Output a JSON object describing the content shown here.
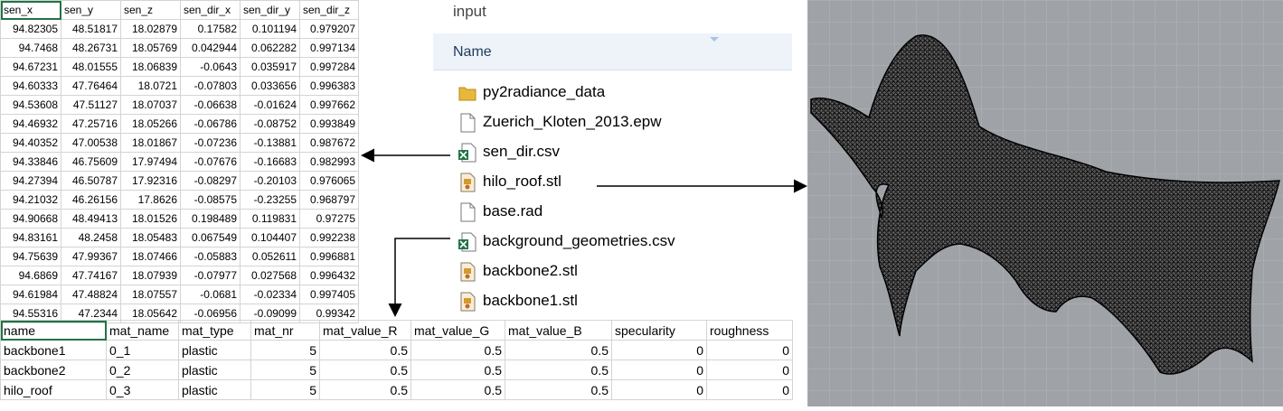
{
  "sensor_table": {
    "headers": [
      "sen_x",
      "sen_y",
      "sen_z",
      "sen_dir_x",
      "sen_dir_y",
      "sen_dir_z"
    ],
    "rows": [
      [
        "94.82305",
        "48.51817",
        "18.02879",
        "0.17582",
        "0.101194",
        "0.979207"
      ],
      [
        "94.7468",
        "48.26731",
        "18.05769",
        "0.042944",
        "0.062282",
        "0.997134"
      ],
      [
        "94.67231",
        "48.01555",
        "18.06839",
        "-0.0643",
        "0.035917",
        "0.997284"
      ],
      [
        "94.60333",
        "47.76464",
        "18.0721",
        "-0.07803",
        "0.033656",
        "0.996383"
      ],
      [
        "94.53608",
        "47.51127",
        "18.07037",
        "-0.06638",
        "-0.01624",
        "0.997662"
      ],
      [
        "94.46932",
        "47.25716",
        "18.05266",
        "-0.06786",
        "-0.08752",
        "0.993849"
      ],
      [
        "94.40352",
        "47.00538",
        "18.01867",
        "-0.07236",
        "-0.13881",
        "0.987672"
      ],
      [
        "94.33846",
        "46.75609",
        "17.97494",
        "-0.07676",
        "-0.16683",
        "0.982993"
      ],
      [
        "94.27394",
        "46.50787",
        "17.92316",
        "-0.08297",
        "-0.20103",
        "0.976065"
      ],
      [
        "94.21032",
        "46.26156",
        "17.8626",
        "-0.08575",
        "-0.23255",
        "0.968797"
      ],
      [
        "94.90668",
        "48.49413",
        "18.01526",
        "0.198489",
        "0.119831",
        "0.97275"
      ],
      [
        "94.83161",
        "48.2458",
        "18.05483",
        "0.067549",
        "0.104407",
        "0.992238"
      ],
      [
        "94.75639",
        "47.99367",
        "18.07466",
        "-0.05883",
        "0.052611",
        "0.996881"
      ],
      [
        "94.6869",
        "47.74167",
        "18.07939",
        "-0.07977",
        "0.027568",
        "0.996432"
      ],
      [
        "94.61984",
        "47.48824",
        "18.07557",
        "-0.0681",
        "-0.02334",
        "0.997405"
      ],
      [
        "94.55316",
        "47.2344",
        "18.05642",
        "-0.06956",
        "-0.09099",
        "0.99342"
      ]
    ]
  },
  "explorer": {
    "folder_title": "input",
    "column_header": "Name",
    "files": [
      {
        "name": "py2radiance_data",
        "icon": "folder-icon"
      },
      {
        "name": "Zuerich_Kloten_2013.epw",
        "icon": "document-icon"
      },
      {
        "name": "sen_dir.csv",
        "icon": "excel-csv-icon"
      },
      {
        "name": "hilo_roof.stl",
        "icon": "stl-file-icon"
      },
      {
        "name": "base.rad",
        "icon": "document-icon"
      },
      {
        "name": "background_geometries.csv",
        "icon": "excel-csv-icon"
      },
      {
        "name": "backbone2.stl",
        "icon": "stl-file-icon"
      },
      {
        "name": "backbone1.stl",
        "icon": "stl-file-icon"
      }
    ]
  },
  "material_table": {
    "headers": [
      "name",
      "mat_name",
      "mat_type",
      "mat_nr",
      "mat_value_R",
      "mat_value_G",
      "mat_value_B",
      "specularity",
      "roughness"
    ],
    "rows": [
      [
        "backbone1",
        "0_1",
        "plastic",
        "5",
        "0.5",
        "0.5",
        "0.5",
        "0",
        "0"
      ],
      [
        "backbone2",
        "0_2",
        "plastic",
        "5",
        "0.5",
        "0.5",
        "0.5",
        "0",
        "0"
      ],
      [
        "hilo_roof",
        "0_3",
        "plastic",
        "5",
        "0.5",
        "0.5",
        "0.5",
        "0",
        "0"
      ]
    ]
  },
  "colors": {
    "excel_green": "#217346",
    "folder_yellow": "#e8b83a",
    "viewport_bg": "#9fa3a8",
    "explorer_header_bg": "#eef3fa"
  }
}
